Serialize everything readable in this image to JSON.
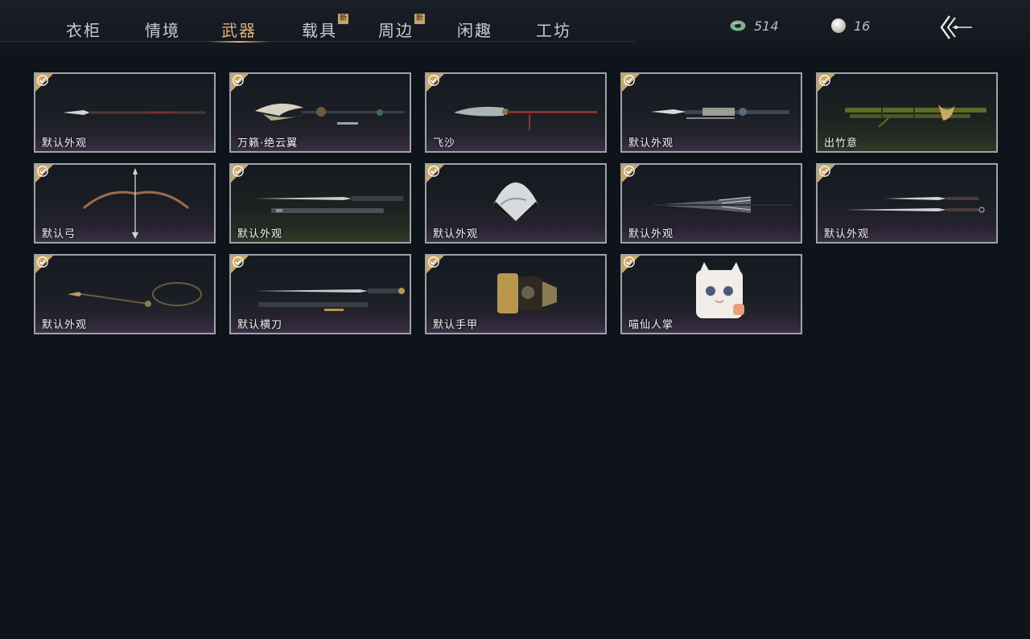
{
  "tabs": [
    {
      "label": "衣柜",
      "active": false,
      "new": false
    },
    {
      "label": "情境",
      "active": false,
      "new": false
    },
    {
      "label": "武器",
      "active": true,
      "new": false
    },
    {
      "label": "载具",
      "active": false,
      "new": true
    },
    {
      "label": "周边",
      "active": false,
      "new": true
    },
    {
      "label": "闲趣",
      "active": false,
      "new": false
    },
    {
      "label": "工坊",
      "active": false,
      "new": false
    }
  ],
  "new_badge": "新",
  "currencies": [
    {
      "icon": "jade-coin-icon",
      "value": "514"
    },
    {
      "icon": "pearl-icon",
      "value": "16"
    }
  ],
  "colors": {
    "accent": "#e2b07a",
    "check": "#c9a66b",
    "background": "#0f131a"
  },
  "items": [
    {
      "label": "默认外观",
      "icon": "spear-icon",
      "owned": true
    },
    {
      "label": "万籁·绝云翼",
      "icon": "winged-spear-icon",
      "owned": true
    },
    {
      "label": "飞沙",
      "icon": "glaive-icon",
      "owned": true
    },
    {
      "label": "默认外观",
      "icon": "ornate-spear-icon",
      "owned": true
    },
    {
      "label": "出竹意",
      "icon": "bamboo-staff-icon",
      "owned": true
    },
    {
      "label": "默认弓",
      "icon": "bow-icon",
      "owned": true
    },
    {
      "label": "默认外观",
      "icon": "sword-and-scabbard-icon",
      "owned": true
    },
    {
      "label": "默认外观",
      "icon": "folding-fan-icon",
      "owned": true
    },
    {
      "label": "默认外观",
      "icon": "umbrella-icon",
      "owned": true
    },
    {
      "label": "默认外观",
      "icon": "twin-blades-icon",
      "owned": true
    },
    {
      "label": "默认外观",
      "icon": "rope-dart-icon",
      "owned": true
    },
    {
      "label": "默认横刀",
      "icon": "hengdao-icon",
      "owned": true
    },
    {
      "label": "默认手甲",
      "icon": "gauntlet-icon",
      "owned": true
    },
    {
      "label": "喵仙人掌",
      "icon": "cat-paw-icon",
      "owned": true
    }
  ]
}
